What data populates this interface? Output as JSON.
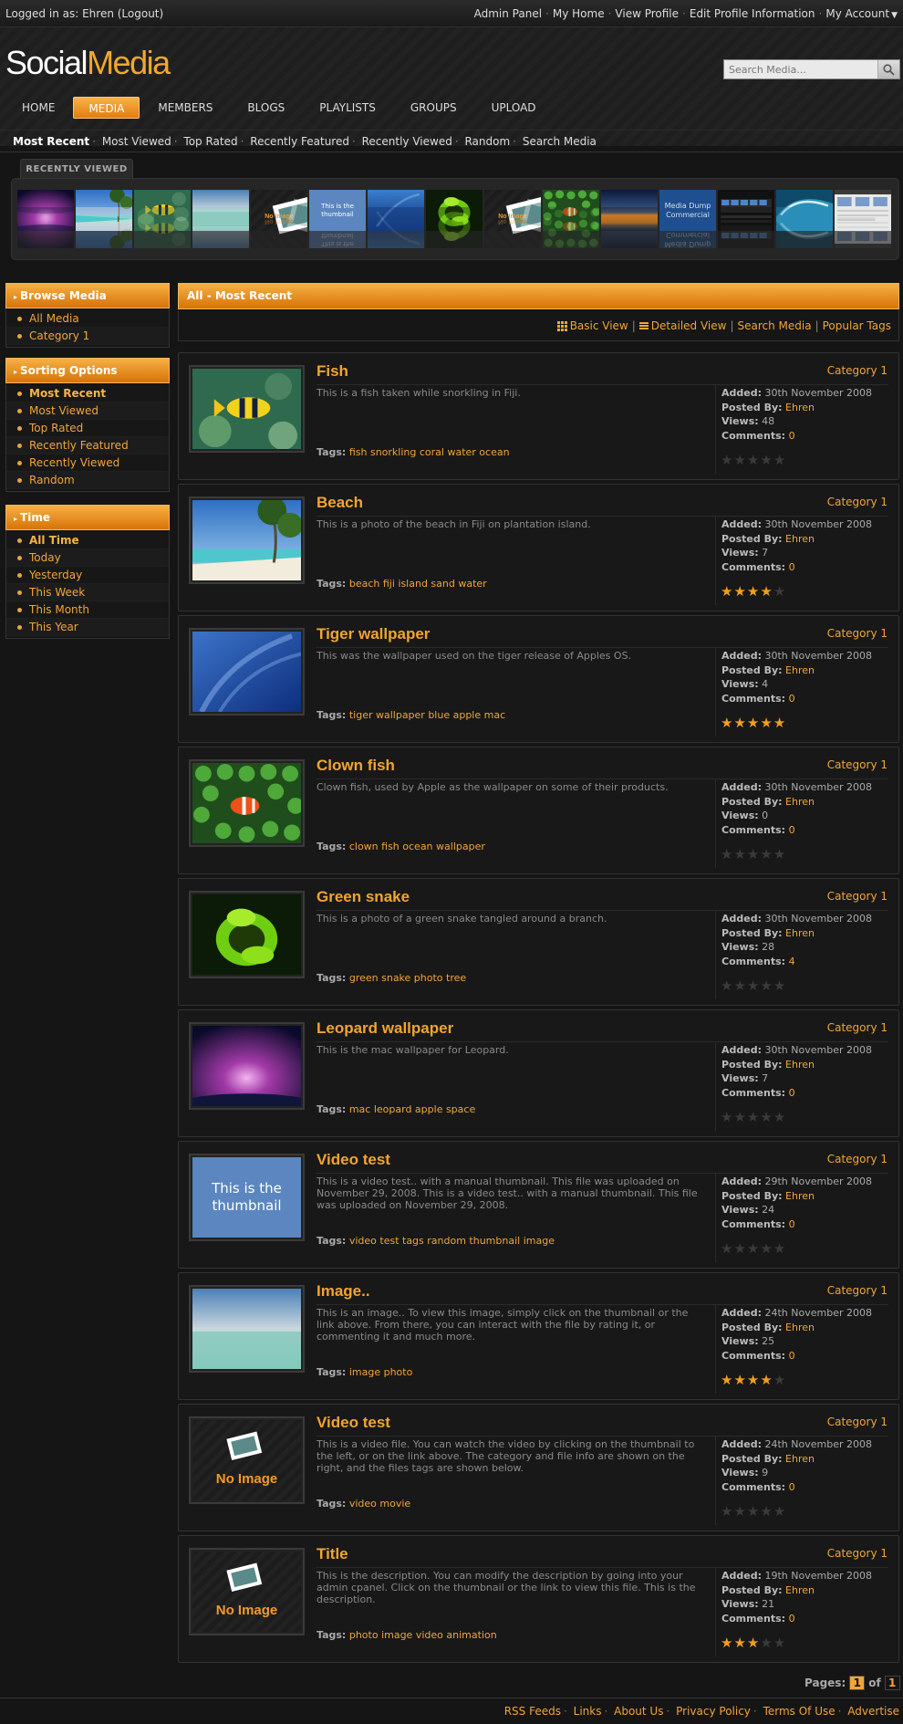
{
  "topbar": {
    "logged_in": "Logged in as: Ehren (Logout)",
    "links": [
      "Admin Panel",
      "My Home",
      "View Profile",
      "Edit Profile Information",
      "My Account"
    ]
  },
  "logo": {
    "part1": "Social",
    "part2": "Media"
  },
  "search": {
    "placeholder": "Search Media..."
  },
  "nav": {
    "items": [
      "HOME",
      "MEDIA",
      "MEMBERS",
      "BLOGS",
      "PLAYLISTS",
      "GROUPS",
      "UPLOAD"
    ],
    "active": "MEDIA"
  },
  "subnav": {
    "items": [
      "Most Recent",
      "Most Viewed",
      "Top Rated",
      "Recently Featured",
      "Recently Viewed",
      "Random",
      "Search Media"
    ]
  },
  "recently_viewed": {
    "title": "RECENTLY VIEWED",
    "thumb_text": {
      "noimage": "No Image",
      "thumbnail": "This is the thumbnail",
      "commercial": "Media Dump Commercial"
    }
  },
  "sidebar": {
    "browse": {
      "title": "Browse Media",
      "items": [
        "All Media",
        "Category 1"
      ]
    },
    "sorting": {
      "title": "Sorting Options",
      "items": [
        "Most Recent",
        "Most Viewed",
        "Top Rated",
        "Recently Featured",
        "Recently Viewed",
        "Random"
      ]
    },
    "time": {
      "title": "Time",
      "items": [
        "All Time",
        "Today",
        "Yesterday",
        "This Week",
        "This Month",
        "This Year"
      ]
    }
  },
  "main": {
    "title": "All - Most Recent",
    "views": {
      "basic": "Basic View",
      "detailed": "Detailed View",
      "search": "Search Media",
      "tags": "Popular Tags"
    }
  },
  "labels": {
    "added": "Added:",
    "posted": "Posted By:",
    "views": "Views:",
    "comments": "Comments:",
    "tags": "Tags:"
  },
  "media": [
    {
      "title": "Fish",
      "category": "Category 1",
      "desc": "This is a fish taken while snorkling in Fiji.",
      "tags": "fish snorkling coral water ocean",
      "added": "30th November 2008",
      "by": "Ehren",
      "views": "48",
      "comments": "0",
      "rating": 0
    },
    {
      "title": "Beach",
      "category": "Category 1",
      "desc": "This is a photo of the beach in Fiji on plantation island.",
      "tags": "beach fiji island sand water",
      "added": "30th November 2008",
      "by": "Ehren",
      "views": "7",
      "comments": "0",
      "rating": 4
    },
    {
      "title": "Tiger wallpaper",
      "category": "Category 1",
      "desc": "This was the wallpaper used on the tiger release of Apples OS.",
      "tags": "tiger wallpaper blue apple mac",
      "added": "30th November 2008",
      "by": "Ehren",
      "views": "4",
      "comments": "0",
      "rating": 5
    },
    {
      "title": "Clown fish",
      "category": "Category 1",
      "desc": "Clown fish, used by Apple as the wallpaper on some of their products.",
      "tags": "clown fish ocean wallpaper",
      "added": "30th November 2008",
      "by": "Ehren",
      "views": "0",
      "comments": "0",
      "rating": 0
    },
    {
      "title": "Green snake",
      "category": "Category 1",
      "desc": "This is a photo of a green snake tangled around a branch.",
      "tags": "green snake photo tree",
      "added": "30th November 2008",
      "by": "Ehren",
      "views": "28",
      "comments": "4",
      "rating": 0
    },
    {
      "title": "Leopard wallpaper",
      "category": "Category 1",
      "desc": "This is the mac wallpaper for Leopard.",
      "tags": "mac leopard apple space",
      "added": "30th November 2008",
      "by": "Ehren",
      "views": "7",
      "comments": "0",
      "rating": 0
    },
    {
      "title": "Video test",
      "category": "Category 1",
      "desc": "This is a video test.. with a manual thumbnail. This file was uploaded on November 29, 2008. This is a video test.. with a manual thumbnail. This file was uploaded on November 29, 2008.",
      "tags": "video test tags random thumbnail image",
      "added": "29th November 2008",
      "by": "Ehren",
      "views": "24",
      "comments": "0",
      "rating": 0
    },
    {
      "title": "Image..",
      "category": "Category 1",
      "desc": "This is an image.. To view this image, simply click on the thumbnail or the link above. From there, you can interact with the file by rating it, or commenting it and much more.",
      "tags": "image photo",
      "added": "24th November 2008",
      "by": "Ehren",
      "views": "25",
      "comments": "0",
      "rating": 4
    },
    {
      "title": "Video test",
      "category": "Category 1",
      "desc": "This is a video file. You can watch the video by clicking on the thumbnail to the left, or on the link above. The category and file info are shown on the right, and the files tags are shown below.",
      "tags": "video movie",
      "added": "24th November 2008",
      "by": "Ehren",
      "views": "9",
      "comments": "0",
      "rating": 0
    },
    {
      "title": "Title",
      "category": "Category 1",
      "desc": "This is the description. You can modify the description by going into your admin cpanel. Click on the thumbnail or the link to view this file. This is the description.",
      "tags": "photo image video animation",
      "added": "19th November 2008",
      "by": "Ehren",
      "views": "21",
      "comments": "0",
      "rating": 3
    }
  ],
  "pagination": {
    "label": "Pages:",
    "current": "1",
    "of": "of",
    "total": "1"
  },
  "footer": {
    "links": [
      "RSS Feeds",
      "Links",
      "About Us",
      "Privacy Policy",
      "Terms Of Use",
      "Advertise"
    ]
  }
}
